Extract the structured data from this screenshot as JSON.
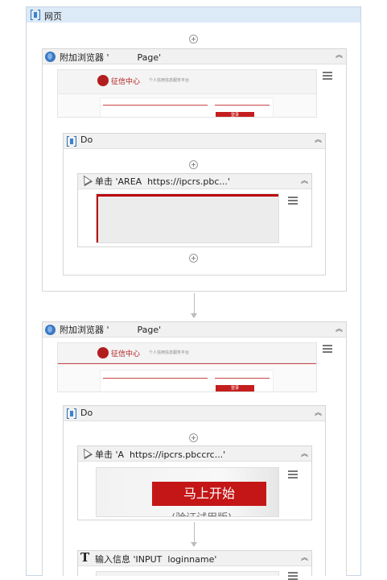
{
  "root": {
    "title": "网页"
  },
  "block1": {
    "title": "附加浏览器 '          Page'",
    "preview": {
      "logo_text": "征信中心",
      "tagline": "个人信用信息服务平台",
      "button": "登录"
    },
    "do": {
      "title": "Do",
      "click": {
        "title": "单击 'AREA  https://ipcrs.pbc...'"
      }
    }
  },
  "block2": {
    "title": "附加浏览器 '          Page'",
    "preview": {
      "logo_text": "征信中心",
      "tagline": "个人信用信息服务平台",
      "button": "登录"
    },
    "do": {
      "title": "Do",
      "click": {
        "title": "单击 'A  https://ipcrs.pbccrc...'",
        "start_button": "马上开始",
        "subtext": "(验证试用版)"
      },
      "type": {
        "title": "输入信息 'INPUT  loginname'"
      }
    }
  }
}
